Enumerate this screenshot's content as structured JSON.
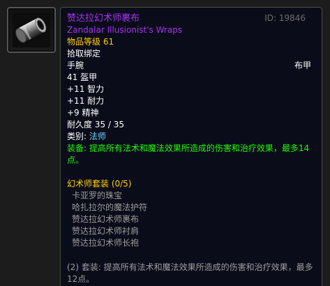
{
  "item": {
    "name_cn": "赞达拉幻术师裹布",
    "name_en": "Zandalar Illusionist's Wraps",
    "id_label": "ID: 19846",
    "item_level": "物品等级 61",
    "bind": "拾取绑定",
    "slot": "手腕",
    "armor_type": "布甲",
    "armor": "41 盔甲",
    "stat_int": "+11 智力",
    "stat_sta": "+11 耐力",
    "stat_spi": "+9 精神",
    "durability": "耐久度 35 / 35",
    "class_label": "类别: ",
    "class_value": "法师",
    "equip_text": "装备: 提高所有法术和魔法效果所造成的伤害和治疗效果，最多14点。"
  },
  "set": {
    "title": "幻术师套装 (0/5)",
    "pieces": [
      "卡亚罗的珠宝",
      "哈扎拉尔的魔法护符",
      "赞达拉幻术师裹布",
      "赞达拉幻术师衬肩",
      "赞达拉幻术师长袍"
    ],
    "bonus": "(2) 套装: 提高所有法术和魔法效果所造成的伤害和治疗效果，最多12点。"
  },
  "icon": {
    "name": "bracer-icon"
  },
  "colors": {
    "epic": "#a335ee",
    "gold": "#ffd100",
    "green": "#1eff00",
    "blue": "#71d5ff",
    "grey": "#9d9d9d"
  }
}
